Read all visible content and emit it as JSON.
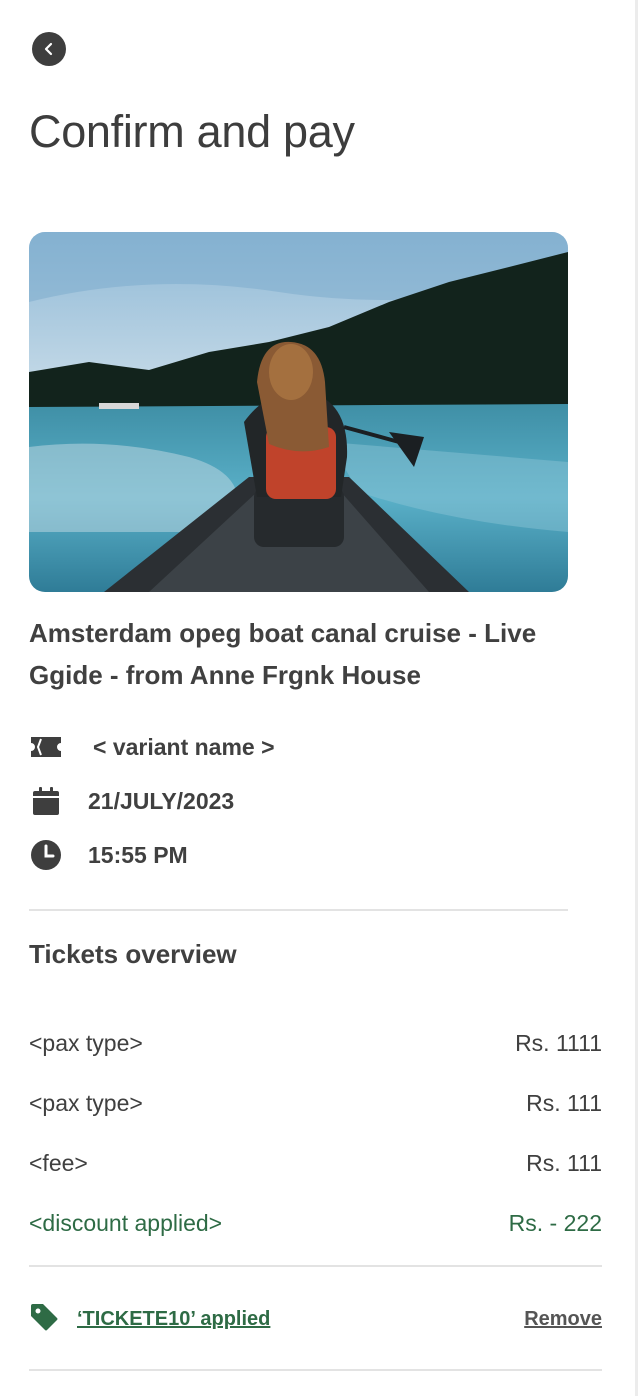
{
  "header": {
    "title": "Confirm and pay"
  },
  "product": {
    "title": "Amsterdam opeg boat canal cruise - Live Ggide - from Anne Frgnk House",
    "variant": "< variant name >",
    "date": "21/JULY/2023",
    "time": "15:55 PM"
  },
  "tickets": {
    "title": "Tickets overview",
    "items": [
      {
        "label": "<pax type>",
        "price": "Rs. 1111"
      },
      {
        "label": "<pax type>",
        "price": "Rs. 111"
      },
      {
        "label": "<fee>",
        "price": "Rs. 111"
      },
      {
        "label": "<discount applied>",
        "price": "Rs. - 222"
      }
    ]
  },
  "promo": {
    "code_text": "‘TICKETE10’ applied",
    "remove_label": "Remove"
  },
  "colors": {
    "accent_green": "#2e6b45",
    "text": "#404040",
    "icon": "#3e3e3e"
  },
  "icons": [
    "chevron-left-icon",
    "ticket-icon",
    "calendar-icon",
    "clock-icon",
    "tag-icon"
  ]
}
